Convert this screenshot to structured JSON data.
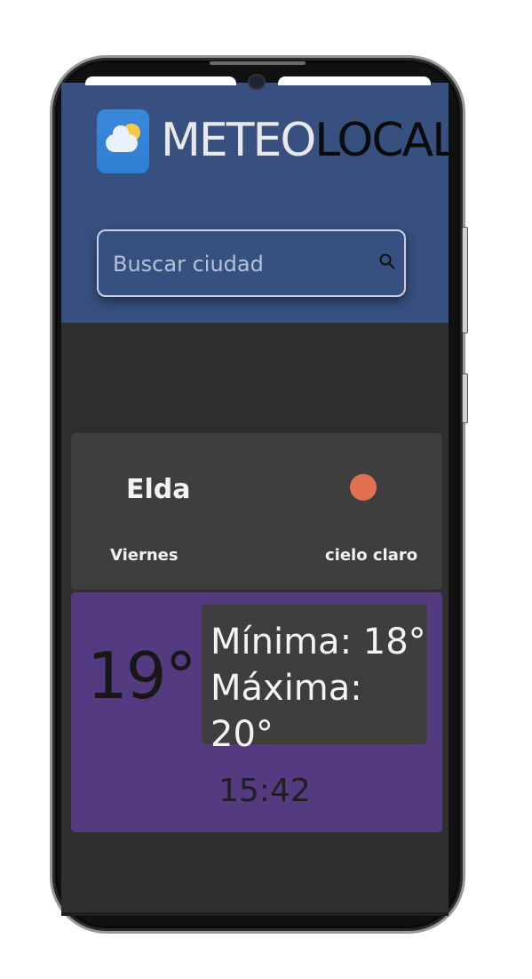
{
  "app": {
    "brand_part1": "METEO",
    "brand_part2": "LOCAL",
    "brand_colors": {
      "header": "#37507f",
      "brand_light": "#e8e8e8",
      "brand_dark": "#0b0b0b"
    },
    "logo_icon": "partly-cloudy-icon"
  },
  "search": {
    "placeholder": "Buscar ciudad",
    "icon": "search-icon"
  },
  "weather": {
    "city": "Elda",
    "day": "Viernes",
    "description": "cielo claro",
    "condition_icon": "sun-icon",
    "current_temp": "19°",
    "min_label": "Mínima: 18°",
    "max_label": "Máxima: 20°",
    "time": "15:42"
  },
  "colors": {
    "background": "#2f2f2f",
    "card": "#3e3e3e",
    "temp_card": "#543a80",
    "sun": "#e07050"
  }
}
